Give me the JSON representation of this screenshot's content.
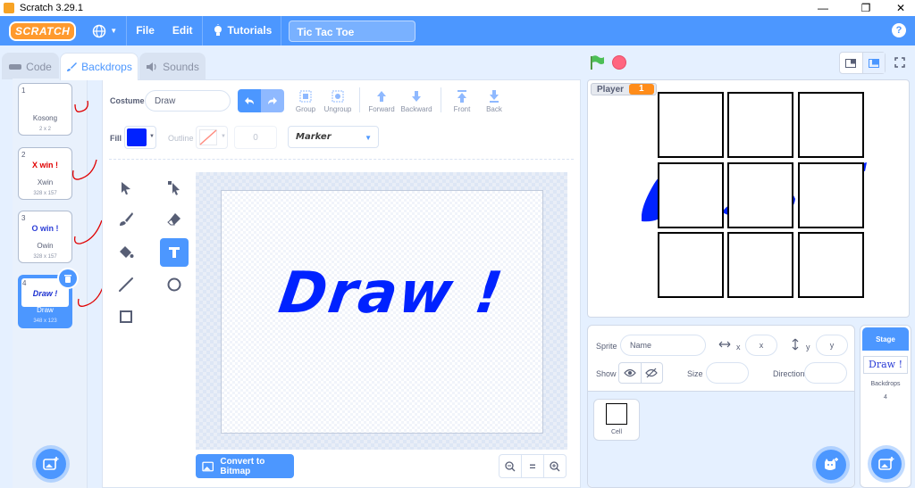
{
  "window": {
    "title": "Scratch 3.29.1",
    "controls": [
      "—",
      "❐",
      "✕"
    ]
  },
  "menu": {
    "logo": "SCRATCH",
    "file": "File",
    "edit": "Edit",
    "tutorials": "Tutorials",
    "project_title": "Tic Tac Toe",
    "help": "?"
  },
  "tabs": {
    "code": "Code",
    "backdrops": "Backdrops",
    "sounds": "Sounds"
  },
  "backdrops": [
    {
      "num": "1",
      "name": "Kosong",
      "size": "2 x 2",
      "preview": ""
    },
    {
      "num": "2",
      "name": "Xwin",
      "size": "328 x 157",
      "preview": "X win !"
    },
    {
      "num": "3",
      "name": "Owin",
      "size": "328 x 157",
      "preview": "O win !"
    },
    {
      "num": "4",
      "name": "Draw",
      "size": "348 x 123",
      "preview": "Draw !"
    }
  ],
  "editor": {
    "costume_label": "Costume",
    "costume_name": "Draw",
    "buttons": {
      "group": "Group",
      "ungroup": "Ungroup",
      "forward": "Forward",
      "backward": "Backward",
      "front": "Front",
      "back": "Back"
    },
    "fill_label": "Fill",
    "fill_color": "#0022ff",
    "outline_label": "Outline",
    "outline_width": "0",
    "font": "Marker",
    "canvas_text": "Draw !",
    "convert_button": "Convert to Bitmap",
    "zoom_equal": "="
  },
  "stage": {
    "player_label": "Player",
    "player_value": "1"
  },
  "sprite_info": {
    "sprite_label": "Sprite",
    "name_placeholder": "Name",
    "x_label": "x",
    "x_placeholder": "x",
    "y_label": "y",
    "y_placeholder": "y",
    "show_label": "Show",
    "size_label": "Size",
    "direction_label": "Direction"
  },
  "sprites": [
    {
      "name": "Cell"
    }
  ],
  "stage_panel": {
    "title": "Stage",
    "preview": "Draw !",
    "backdrops_label": "Backdrops",
    "backdrops_count": "4"
  },
  "colors": {
    "accent": "#4c97ff",
    "brand_orange": "#ff9a2e",
    "draw_blue": "#0022ff",
    "annotation_red": "#e00000"
  }
}
